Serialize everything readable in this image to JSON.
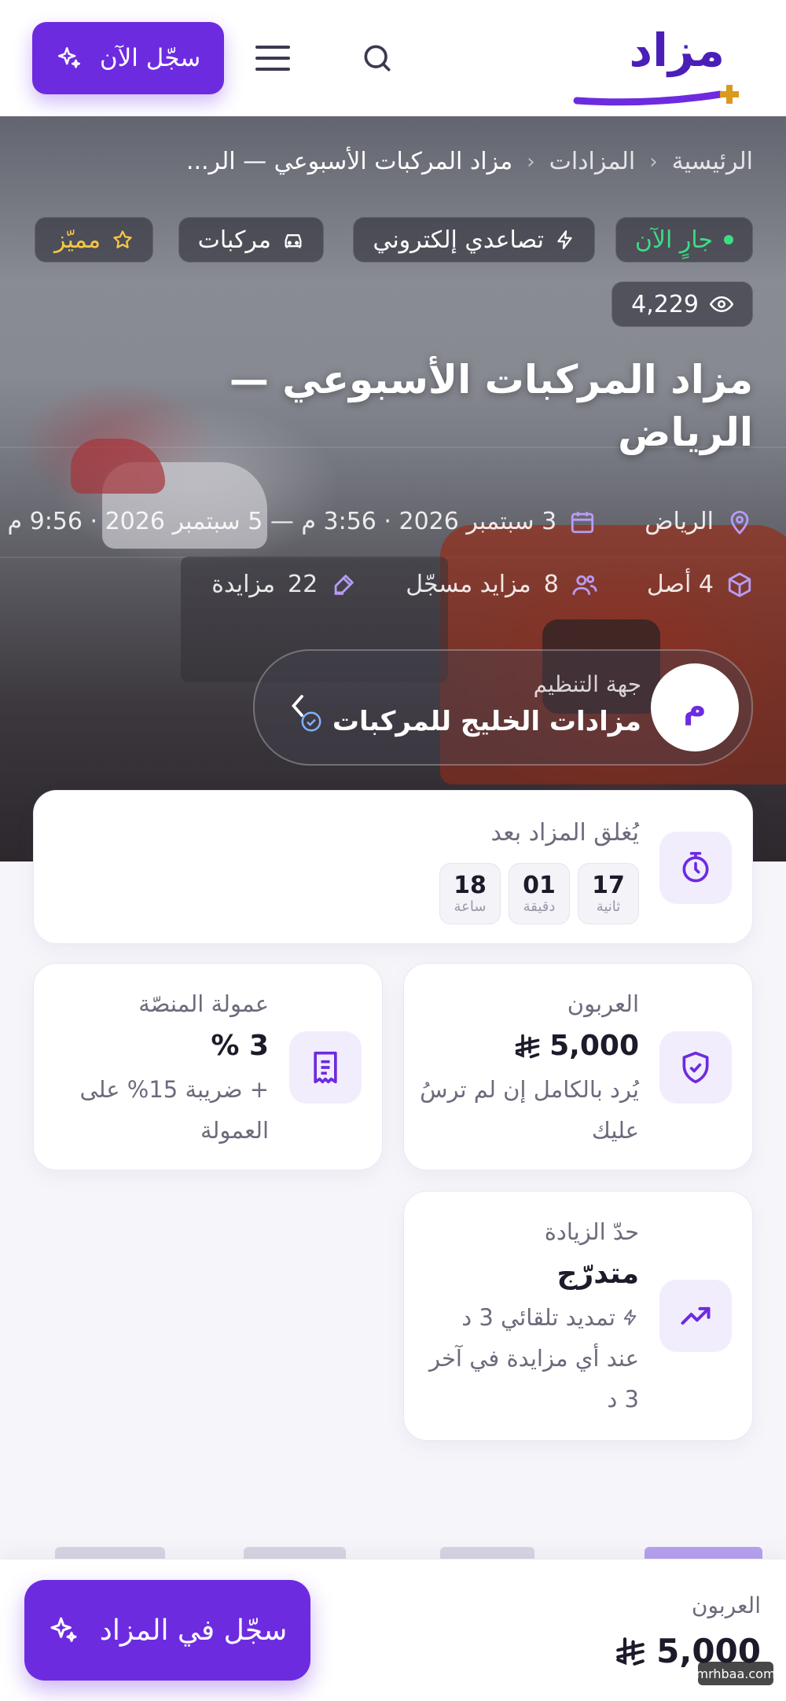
{
  "header": {
    "logo_text": "مزاد",
    "signup_label": "سجّل الآن",
    "icons": [
      "search-icon",
      "menu-icon",
      "sparkle-icon"
    ]
  },
  "breadcrumb": {
    "home": "الرئيسية",
    "auctions": "المزادات",
    "current": "مزاد المركبات الأسبوعي — الر..."
  },
  "badges": {
    "status": "جارٍ الآن",
    "type": "تصاعدي إلكتروني",
    "category": "مركبات",
    "featured": "مميّز",
    "views": "4,229"
  },
  "auction": {
    "title": "مزاد المركبات الأسبوعي — الرياض",
    "city": "الرياض",
    "dates": "3 سبتمبر 2026 · 3:56 م — 5 سبتمبر 2026 · 9:56 م",
    "assets": "4 أصل",
    "bidders_count": "8",
    "bidders_label": "مزايد مسجّل",
    "bids_count": "22",
    "bids_label": "مزايدة"
  },
  "organizer": {
    "label": "جهة التنظيم",
    "name": "مزادات الخليج للمركبات",
    "initial": "م"
  },
  "timer": {
    "label": "يُغلق المزاد بعد",
    "seconds": "17",
    "seconds_unit": "ثانية",
    "minutes": "01",
    "minutes_unit": "دقيقة",
    "hours": "18",
    "hours_unit": "ساعة"
  },
  "deposit": {
    "label": "العربون",
    "value": "5,000",
    "desc": "يُرد بالكامل إن لم ترسُ عليك"
  },
  "fee": {
    "label": "عمولة المنصّة",
    "value": "3 %",
    "desc": "+ ضريبة 15% على العمولة"
  },
  "increment": {
    "label": "حدّ الزيادة",
    "value": "متدرّج",
    "desc_line1": "تمديد تلقائي 3 د",
    "desc_line2": "عند أي مزايدة في آخر 3 د"
  },
  "bottom_bar": {
    "label": "العربون",
    "value": "5,000",
    "cta": "سجّل في المزاد"
  },
  "watermark": "mrhbaa.com",
  "colors": {
    "brand": "#6d2be0",
    "brand_dark": "#4a1fb8",
    "live": "#3ddc84",
    "featured": "#f6c744",
    "logo_accent": "#d99a1e"
  }
}
